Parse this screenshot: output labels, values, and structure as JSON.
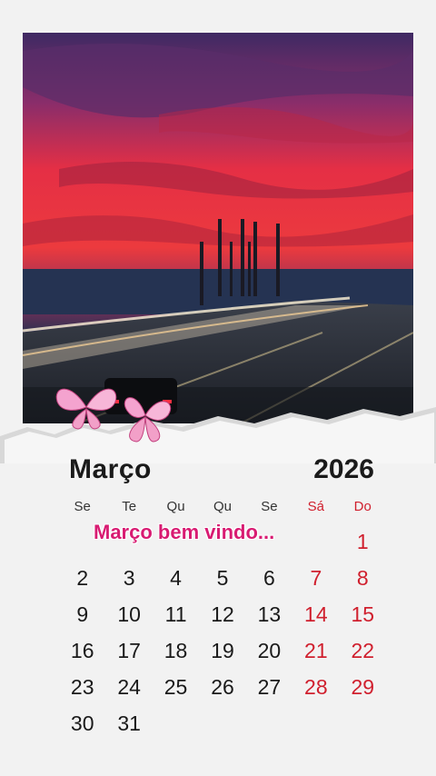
{
  "calendar": {
    "month": "Março",
    "year": "2026",
    "greeting": "Março bem vindo...",
    "weekdays": [
      {
        "label": "Se",
        "weekend": false
      },
      {
        "label": "Te",
        "weekend": false
      },
      {
        "label": "Qu",
        "weekend": false
      },
      {
        "label": "Qu",
        "weekend": false
      },
      {
        "label": "Se",
        "weekend": false
      },
      {
        "label": "Sá",
        "weekend": true
      },
      {
        "label": "Do",
        "weekend": true
      }
    ],
    "weeks": [
      [
        "",
        "",
        "",
        "",
        "",
        "",
        "1"
      ],
      [
        "2",
        "3",
        "4",
        "5",
        "6",
        "7",
        "8"
      ],
      [
        "9",
        "10",
        "11",
        "12",
        "13",
        "14",
        "15"
      ],
      [
        "16",
        "17",
        "18",
        "19",
        "20",
        "21",
        "22"
      ],
      [
        "23",
        "24",
        "25",
        "26",
        "27",
        "28",
        "29"
      ],
      [
        "30",
        "31",
        "",
        "",
        "",
        "",
        ""
      ]
    ],
    "weekend_color": "#d0202e",
    "greeting_color": "#d81b72"
  },
  "photo": {
    "sky_colors": [
      "#4a2f6e",
      "#e8304a",
      "#1f2a48"
    ],
    "butterfly_color": "#f6a8d4"
  }
}
